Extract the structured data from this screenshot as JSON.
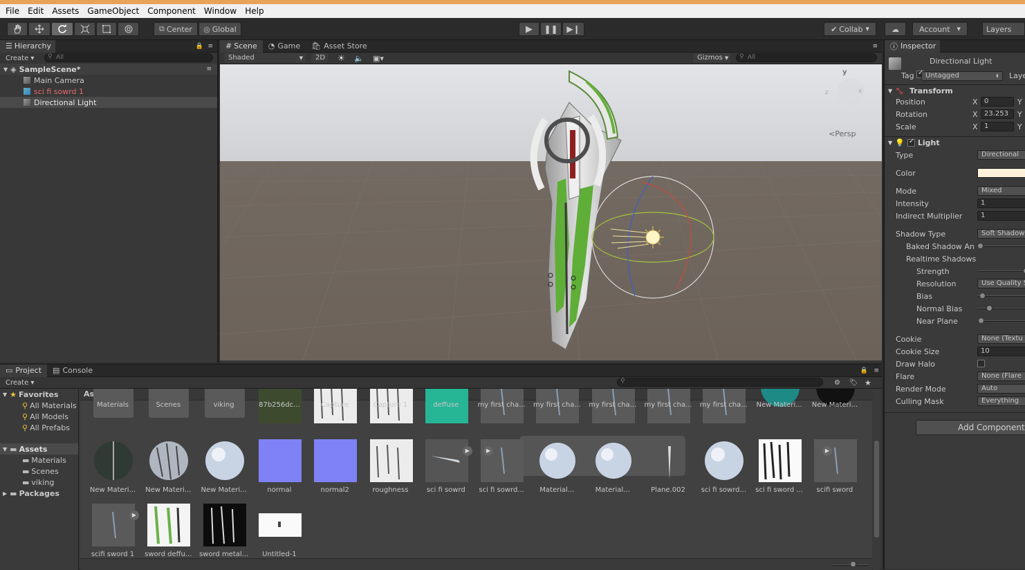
{
  "menu": [
    "File",
    "Edit",
    "Assets",
    "GameObject",
    "Component",
    "Window",
    "Help"
  ],
  "toolbar": {
    "center": "Center",
    "global": "Global",
    "collab": "Collab",
    "account": "Account",
    "layers": "Layers"
  },
  "hierarchy": {
    "tab": "Hierarchy",
    "create": "Create",
    "search": "All",
    "scene": "SampleScene*",
    "items": [
      {
        "label": "Main Camera"
      },
      {
        "label": "sci fi sowrd 1"
      },
      {
        "label": "Directional Light"
      }
    ]
  },
  "scene": {
    "tabs": [
      "Scene",
      "Game",
      "Asset Store"
    ],
    "shading": "Shaded",
    "mode2d": "2D",
    "gizmos": "Gizmos",
    "search": "All",
    "persp": "Persp",
    "axis_y": "y",
    "axis_x": "x",
    "axis_z": "z"
  },
  "project": {
    "tabs": [
      "Project",
      "Console"
    ],
    "create": "Create",
    "breadcrumb": "Assets",
    "favorites": {
      "label": "Favorites",
      "items": [
        "All Materials",
        "All Models",
        "All Prefabs"
      ]
    },
    "assets": {
      "label": "Assets",
      "items": [
        "Materials",
        "Scenes",
        "viking"
      ]
    },
    "packages": "Packages",
    "row1": [
      "Materials",
      "Scenes",
      "viking",
      "87b256dc...",
      "Capture",
      "Capture 1",
      "deffuse",
      "my first cha...",
      "my first cha...",
      "my first cha...",
      "my first cha...",
      "my first cha...",
      "New Materi...",
      "New Materi..."
    ],
    "row2": [
      "New Materi...",
      "New Materi...",
      "New Materi...",
      "normal",
      "normal2",
      "roughness",
      "sci fi sowrd",
      "sci fi sowrd...",
      "Material...",
      "Material...",
      "Plane.002",
      "sci fi sowrd...",
      "sci fi sword ...",
      "scifi sword"
    ],
    "row3": [
      "scifi sword 1",
      "sword deffu...",
      "sword metal...",
      "Untitled-1"
    ]
  },
  "inspector": {
    "tab": "Inspector",
    "object": "Directional Light",
    "tag_label": "Tag",
    "tag": "Untagged",
    "layer_label": "Laye",
    "transform": {
      "title": "Transform",
      "position": "Position",
      "rotation": "Rotation",
      "scale": "Scale",
      "x": "X",
      "y": "Y",
      "pos_x": "0",
      "rot_x": "23.253",
      "scale_x": "1"
    },
    "light": {
      "title": "Light",
      "type_label": "Type",
      "type": "Directional",
      "color_label": "Color",
      "mode_label": "Mode",
      "mode": "Mixed",
      "intensity_label": "Intensity",
      "intensity": "1",
      "indirect_label": "Indirect Multiplier",
      "indirect": "1",
      "shadow_type_label": "Shadow Type",
      "shadow_type": "Soft Shadows",
      "baked_label": "Baked Shadow An",
      "realtime_label": "Realtime Shadows",
      "strength_label": "Strength",
      "resolution_label": "Resolution",
      "resolution": "Use Quality S",
      "bias_label": "Bias",
      "normal_bias_label": "Normal Bias",
      "near_plane_label": "Near Plane",
      "cookie_label": "Cookie",
      "cookie": "None (Textu",
      "cookie_size_label": "Cookie Size",
      "cookie_size": "10",
      "draw_halo_label": "Draw Halo",
      "flare_label": "Flare",
      "flare": "None (Flare",
      "render_mode_label": "Render Mode",
      "render_mode": "Auto",
      "culling_label": "Culling Mask",
      "culling": "Everything"
    },
    "add_component": "Add Component"
  },
  "colors": {
    "light_color": "#fff2dc",
    "deffuse": "#26b595",
    "normal": "#7f82f5",
    "play_bar": "#2b2b2b"
  }
}
